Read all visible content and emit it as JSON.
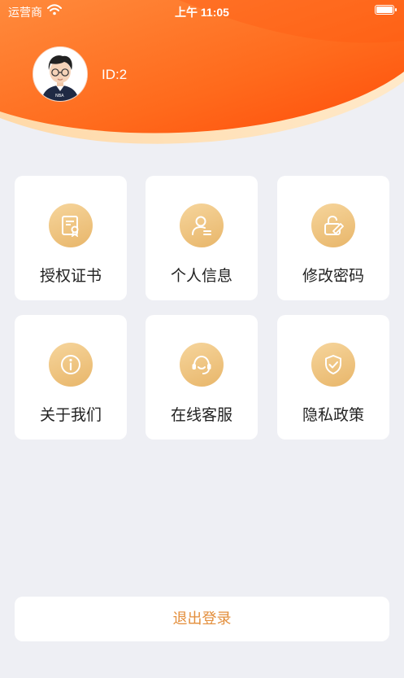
{
  "status_bar": {
    "carrier": "运营商",
    "time": "上午 11:05",
    "wifi_icon": "wifi-icon",
    "battery_icon": "battery-icon"
  },
  "profile": {
    "id_text": "ID:2"
  },
  "menu": [
    {
      "label": "授权证书",
      "icon": "certificate-icon"
    },
    {
      "label": "个人信息",
      "icon": "user-icon"
    },
    {
      "label": "修改密码",
      "icon": "lock-edit-icon"
    },
    {
      "label": "关于我们",
      "icon": "info-icon"
    },
    {
      "label": "在线客服",
      "icon": "headset-icon"
    },
    {
      "label": "隐私政策",
      "icon": "shield-check-icon"
    }
  ],
  "logout_label": "退出登录",
  "colors": {
    "header_start": "#ff7a2e",
    "header_end": "#ff4f0b",
    "icon_bg": "#eec07d",
    "logout_text": "#e38e3b",
    "page_bg": "#eeeff4"
  }
}
